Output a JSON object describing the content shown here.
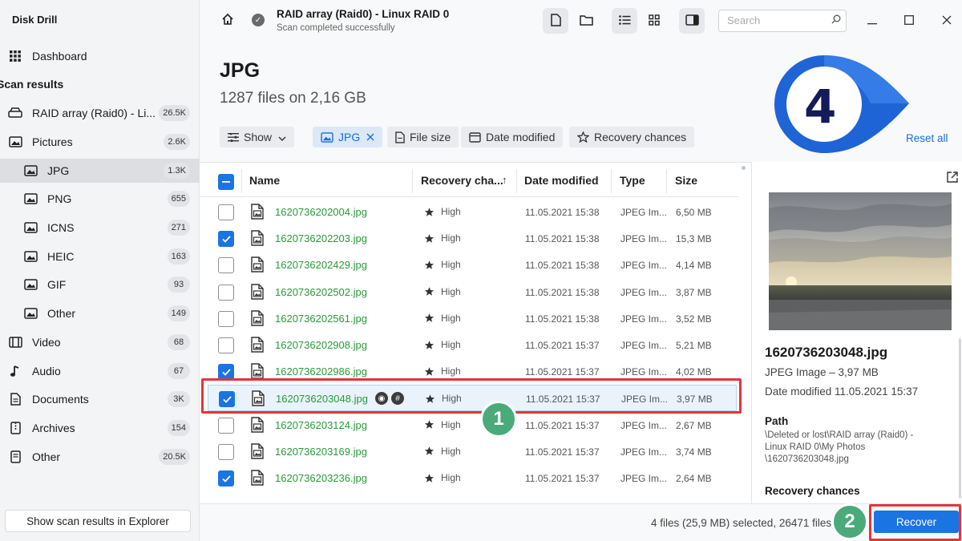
{
  "sidebar": {
    "app_title": "Disk Drill",
    "dashboard": "Dashboard",
    "section_title": "Scan results",
    "items": [
      {
        "label": "RAID array (Raid0) - Li...",
        "count": "26.5K"
      },
      {
        "label": "Pictures",
        "count": "2.6K"
      },
      {
        "label": "JPG",
        "count": "1.3K"
      },
      {
        "label": "PNG",
        "count": "655"
      },
      {
        "label": "ICNS",
        "count": "271"
      },
      {
        "label": "HEIC",
        "count": "163"
      },
      {
        "label": "GIF",
        "count": "93"
      },
      {
        "label": "Other",
        "count": "149"
      },
      {
        "label": "Video",
        "count": "68"
      },
      {
        "label": "Audio",
        "count": "67"
      },
      {
        "label": "Documents",
        "count": "3K"
      },
      {
        "label": "Archives",
        "count": "154"
      },
      {
        "label": "Other",
        "count": "20.5K"
      }
    ],
    "explorer_button": "Show scan results in Explorer"
  },
  "topbar": {
    "title": "RAID array (Raid0) - Linux RAID 0",
    "subtitle": "Scan completed successfully",
    "search_placeholder": "Search"
  },
  "header": {
    "title": "JPG",
    "subtitle": "1287 files on 2,16 GB",
    "filters": {
      "show": "Show",
      "jpg": "JPG",
      "file_size": "File size",
      "date_modified": "Date modified",
      "recovery_chances": "Recovery chances"
    },
    "reset_all": "Reset all",
    "annotation_number": "4"
  },
  "table": {
    "columns": {
      "name": "Name",
      "recovery": "Recovery cha...",
      "date": "Date modified",
      "type": "Type",
      "size": "Size"
    },
    "rows": [
      {
        "name": "1620736202004.jpg",
        "recovery": "High",
        "date": "11.05.2021 15:38",
        "type": "JPEG Im...",
        "size": "6,50 MB",
        "checked": false
      },
      {
        "name": "1620736202203.jpg",
        "recovery": "High",
        "date": "11.05.2021 15:38",
        "type": "JPEG Im...",
        "size": "15,3 MB",
        "checked": true
      },
      {
        "name": "1620736202429.jpg",
        "recovery": "High",
        "date": "11.05.2021 15:38",
        "type": "JPEG Im...",
        "size": "4,14 MB",
        "checked": false
      },
      {
        "name": "1620736202502.jpg",
        "recovery": "High",
        "date": "11.05.2021 15:38",
        "type": "JPEG Im...",
        "size": "3,87 MB",
        "checked": false
      },
      {
        "name": "1620736202561.jpg",
        "recovery": "High",
        "date": "11.05.2021 15:38",
        "type": "JPEG Im...",
        "size": "3,52 MB",
        "checked": false
      },
      {
        "name": "1620736202908.jpg",
        "recovery": "High",
        "date": "11.05.2021 15:37",
        "type": "JPEG Im...",
        "size": "5,21 MB",
        "checked": false
      },
      {
        "name": "1620736202986.jpg",
        "recovery": "High",
        "date": "11.05.2021 15:37",
        "type": "JPEG Im...",
        "size": "4,02 MB",
        "checked": true
      },
      {
        "name": "1620736203048.jpg",
        "recovery": "High",
        "date": "11.05.2021 15:37",
        "type": "JPEG Im...",
        "size": "3,97 MB",
        "checked": true
      },
      {
        "name": "1620736203124.jpg",
        "recovery": "High",
        "date": "11.05.2021 15:37",
        "type": "JPEG Im...",
        "size": "2,67 MB",
        "checked": false
      },
      {
        "name": "1620736203169.jpg",
        "recovery": "High",
        "date": "11.05.2021 15:37",
        "type": "JPEG Im...",
        "size": "3,74 MB",
        "checked": false
      },
      {
        "name": "1620736203236.jpg",
        "recovery": "High",
        "date": "11.05.2021 15:37",
        "type": "JPEG Im...",
        "size": "2,64 MB",
        "checked": true
      }
    ]
  },
  "preview": {
    "file_name": "1620736203048.jpg",
    "type_size": "JPEG Image – 3,97 MB",
    "date_modified": "Date modified 11.05.2021 15:37",
    "path_label": "Path",
    "path_value": "\\Deleted or lost\\RAID array (Raid0) - Linux RAID 0\\My Photos \\1620736203048.jpg",
    "recovery_label": "Recovery chances"
  },
  "status": {
    "selection_text": "4 files (25,9 MB) selected, 26471 files",
    "recover_button": "Recover"
  },
  "annotations": {
    "badge_1": "1",
    "badge_2": "2"
  },
  "colors": {
    "accent": "#1b74e4",
    "file_name_green": "#2a9a3a",
    "annotation_red": "#e0363a",
    "badge_green": "#4aaa7a"
  }
}
